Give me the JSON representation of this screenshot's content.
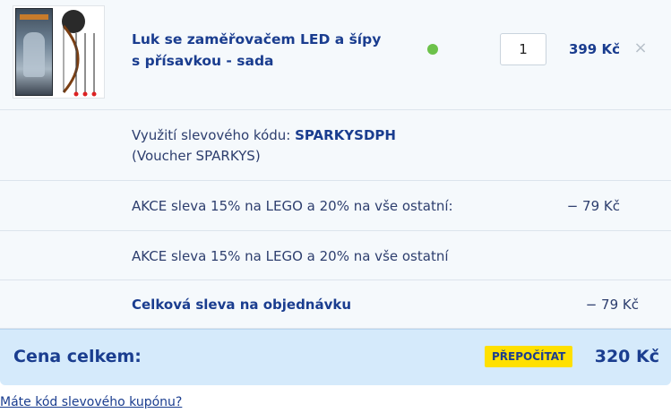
{
  "product": {
    "name": "Luk se zaměřovačem LED a šípy s přísavkou - sada",
    "quantity": "1",
    "price": "399 Kč",
    "remove_label": "×",
    "stock_color": "#6cc24a"
  },
  "voucher": {
    "prefix": "Využití slevového kódu: ",
    "code": "SPARKYSDPH",
    "subtitle": "(Voucher SPARKYS)"
  },
  "discounts": [
    {
      "label": "AKCE sleva 15% na LEGO a 20% na vše ostatní:",
      "amount": "− 79 Kč"
    },
    {
      "label": "AKCE sleva 15% na LEGO a 20% na vše ostatní",
      "amount": ""
    }
  ],
  "total_discount": {
    "label": "Celková sleva na objednávku",
    "amount": "− 79 Kč"
  },
  "grand_total": {
    "label": "Cena celkem:",
    "recalc_label": "PŘEPOČÍTAT",
    "amount": "320 Kč"
  },
  "coupon_link": "Máte kód slevového kupónu?",
  "colors": {
    "accent": "#1a3d8f",
    "total_bar": "#d5eafb",
    "recalc_button": "#ffe000"
  }
}
